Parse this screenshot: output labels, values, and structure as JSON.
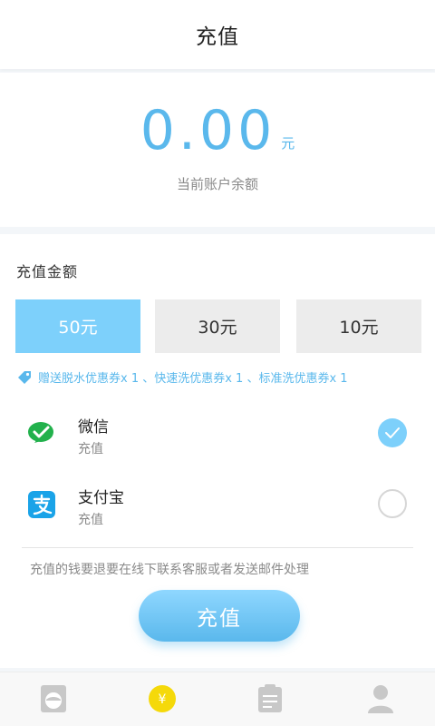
{
  "header": {
    "title": "充值"
  },
  "balance": {
    "amount": "0.00",
    "unit": "元",
    "label": "当前账户余额"
  },
  "recharge": {
    "section_title": "充值金额",
    "amounts": [
      {
        "label": "50元",
        "selected": true
      },
      {
        "label": "30元",
        "selected": false
      },
      {
        "label": "10元",
        "selected": false
      }
    ],
    "promo_text": "赠送脱水优惠券x 1 、快速洗优惠券x 1 、标准洗优惠券x 1"
  },
  "payment_methods": [
    {
      "name": "微信",
      "sub": "充值",
      "icon": "wechat-icon",
      "checked": true
    },
    {
      "name": "支付宝",
      "sub": "充值",
      "icon": "alipay-icon",
      "checked": false
    }
  ],
  "notice": "充值的钱要退要在线下联系客服或者发送邮件处理",
  "submit_label": "充值",
  "tabbar": {
    "tabs": [
      {
        "icon": "washer-icon",
        "active": false
      },
      {
        "icon": "yen-coin-icon",
        "active": true
      },
      {
        "icon": "clipboard-icon",
        "active": false
      },
      {
        "icon": "user-icon",
        "active": false
      }
    ]
  },
  "colors": {
    "accent": "#5ab8ec",
    "selected_bg": "#7dd0fb",
    "wechat_green": "#22b14c",
    "alipay_blue": "#1aa3e8",
    "coin_yellow": "#f5d90a",
    "tab_gray": "#c8c8c8"
  }
}
